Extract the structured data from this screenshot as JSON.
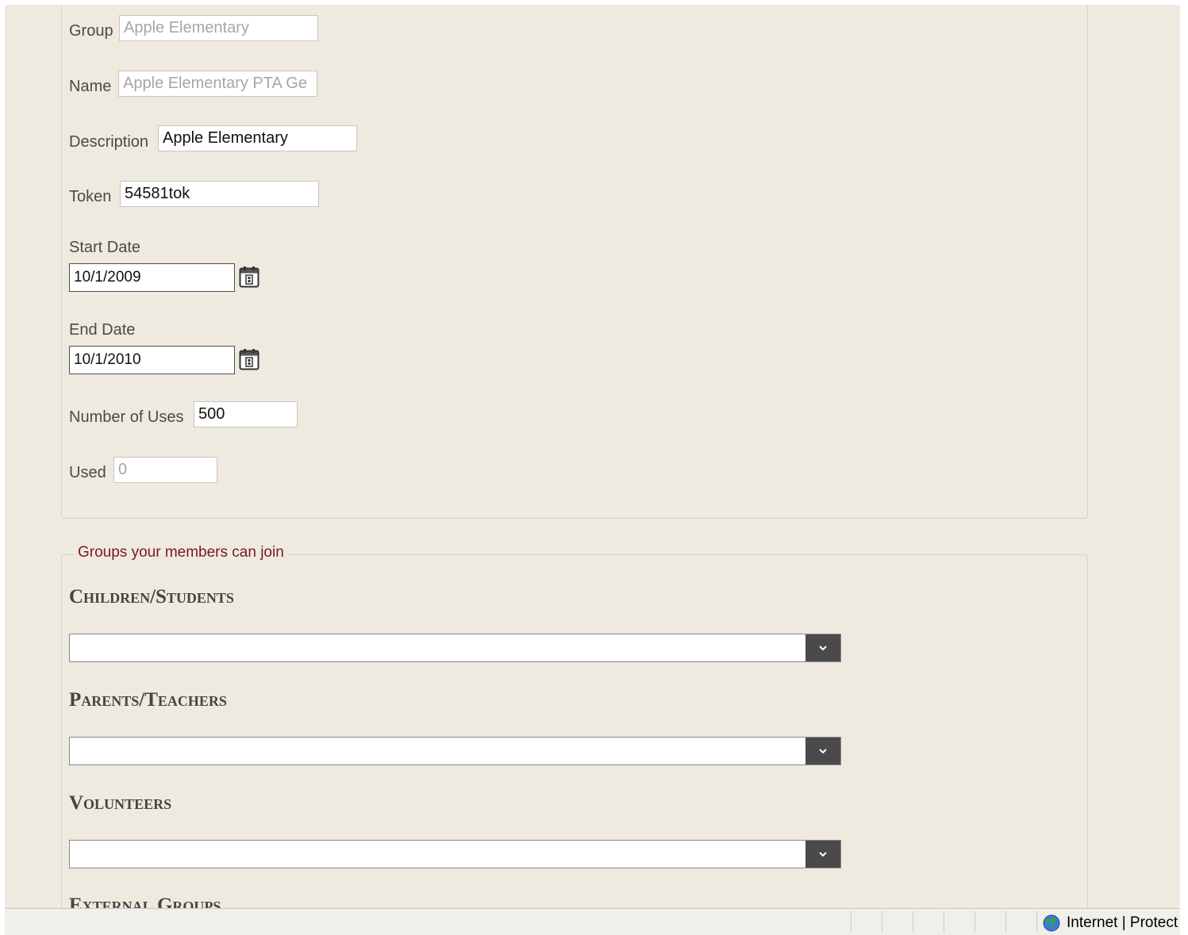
{
  "form": {
    "group_label": "Group",
    "group_value": "Apple Elementary",
    "name_label": "Name",
    "name_value": "Apple Elementary PTA Ge",
    "description_label": "Description",
    "description_value": "Apple Elementary",
    "token_label": "Token",
    "token_value": "54581tok",
    "start_date_label": "Start Date",
    "start_date_value": "10/1/2009",
    "end_date_label": "End Date",
    "end_date_value": "10/1/2010",
    "uses_label": "Number of Uses",
    "uses_value": "500",
    "used_label": "Used",
    "used_value": "0"
  },
  "groups": {
    "legend": "Groups your members can join",
    "children_heading": "Children/Students",
    "children_selected": "",
    "parents_heading": "Parents/Teachers",
    "parents_selected": "",
    "volunteers_heading": "Volunteers",
    "volunteers_selected": "",
    "external_heading": "External Groups"
  },
  "statusbar": {
    "zone_text": "Internet | Protect",
    "zone_icon": "globe-icon"
  },
  "colors": {
    "page_bg": "#eeeadf",
    "legend": "#7a1a1a",
    "select_button": "#4a4a4a"
  }
}
